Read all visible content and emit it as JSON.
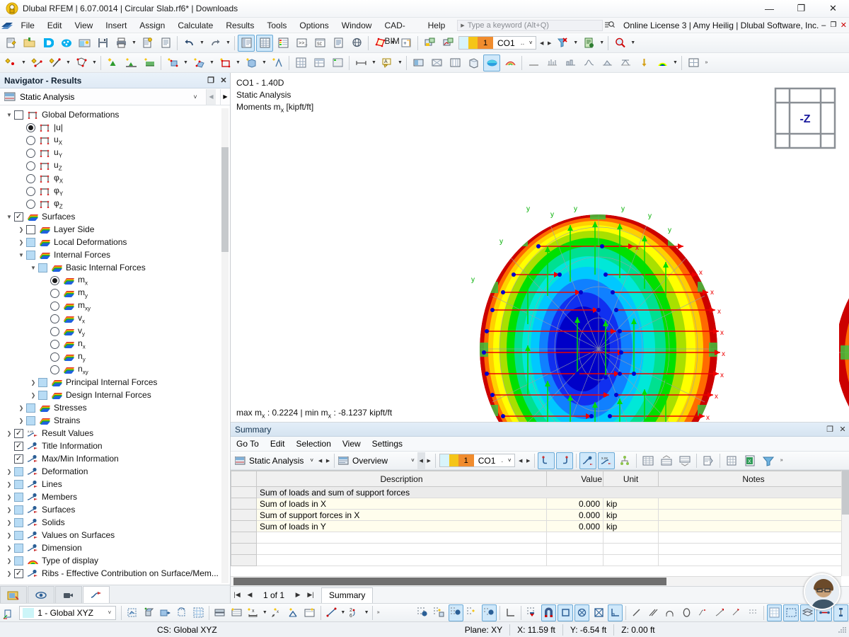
{
  "window": {
    "title": "Dlubal RFEM | 6.07.0014 | Circular Slab.rf6* | Downloads",
    "minimize": "—",
    "maximize": "❐",
    "close": "✕"
  },
  "menubar": {
    "items": [
      "File",
      "Edit",
      "View",
      "Insert",
      "Assign",
      "Calculate",
      "Results",
      "Tools",
      "Options",
      "Window",
      "CAD-BIM",
      "Help"
    ],
    "quick_find_placeholder": "Type a keyword (Alt+Q)",
    "license": "Online License 3 | Amy Heilig | Dlubal Software, Inc."
  },
  "toolbar": {
    "load_case": {
      "number": "1",
      "name": "CO1",
      "dots": ".."
    }
  },
  "navigator": {
    "title": "Navigator - Results",
    "restore_label": "❐",
    "close_label": "✕",
    "analysis_type": "Static Analysis",
    "tree": [
      {
        "label": "Global Deformations",
        "indent": 0,
        "expander": "v",
        "ctl": "check",
        "checked": false,
        "icon": "frame-icon"
      },
      {
        "label": "|u|",
        "indent": 1,
        "expander": "",
        "ctl": "radio",
        "checked": true,
        "icon": "frame-icon"
      },
      {
        "label": "uX",
        "indent": 1,
        "expander": "",
        "ctl": "radio",
        "checked": false,
        "icon": "frame-icon"
      },
      {
        "label": "uY",
        "indent": 1,
        "expander": "",
        "ctl": "radio",
        "checked": false,
        "icon": "frame-icon"
      },
      {
        "label": "uZ",
        "indent": 1,
        "expander": "",
        "ctl": "radio",
        "checked": false,
        "icon": "frame-icon"
      },
      {
        "label": "φX",
        "indent": 1,
        "expander": "",
        "ctl": "radio",
        "checked": false,
        "icon": "frame-icon"
      },
      {
        "label": "φY",
        "indent": 1,
        "expander": "",
        "ctl": "radio",
        "checked": false,
        "icon": "frame-icon"
      },
      {
        "label": "φZ",
        "indent": 1,
        "expander": "",
        "ctl": "radio",
        "checked": false,
        "icon": "frame-icon"
      },
      {
        "label": "Surfaces",
        "indent": 0,
        "expander": "v",
        "ctl": "check",
        "checked": true,
        "icon": "surface-icon"
      },
      {
        "label": "Layer Side",
        "indent": 1,
        "expander": ">",
        "ctl": "check",
        "checked": false,
        "icon": "surface-icon"
      },
      {
        "label": "Local Deformations",
        "indent": 1,
        "expander": ">",
        "ctl": "check-blue",
        "checked": false,
        "icon": "surface-icon"
      },
      {
        "label": "Internal Forces",
        "indent": 1,
        "expander": "v",
        "ctl": "check-blue",
        "checked": false,
        "icon": "surface-icon"
      },
      {
        "label": "Basic Internal Forces",
        "indent": 2,
        "expander": "v",
        "ctl": "check-blue",
        "checked": false,
        "icon": "surface-icon"
      },
      {
        "label": "mx",
        "indent": 3,
        "expander": "",
        "ctl": "radio",
        "checked": true,
        "icon": "surface-icon"
      },
      {
        "label": "my",
        "indent": 3,
        "expander": "",
        "ctl": "radio",
        "checked": false,
        "icon": "surface-icon"
      },
      {
        "label": "mxy",
        "indent": 3,
        "expander": "",
        "ctl": "radio",
        "checked": false,
        "icon": "surface-icon"
      },
      {
        "label": "vx",
        "indent": 3,
        "expander": "",
        "ctl": "radio",
        "checked": false,
        "icon": "surface-icon"
      },
      {
        "label": "vy",
        "indent": 3,
        "expander": "",
        "ctl": "radio",
        "checked": false,
        "icon": "surface-icon"
      },
      {
        "label": "nx",
        "indent": 3,
        "expander": "",
        "ctl": "radio",
        "checked": false,
        "icon": "surface-icon"
      },
      {
        "label": "ny",
        "indent": 3,
        "expander": "",
        "ctl": "radio",
        "checked": false,
        "icon": "surface-icon"
      },
      {
        "label": "nxy",
        "indent": 3,
        "expander": "",
        "ctl": "radio",
        "checked": false,
        "icon": "surface-icon"
      },
      {
        "label": "Principal Internal Forces",
        "indent": 2,
        "expander": ">",
        "ctl": "check-blue",
        "checked": false,
        "icon": "surface-icon"
      },
      {
        "label": "Design Internal Forces",
        "indent": 2,
        "expander": ">",
        "ctl": "check-blue",
        "checked": false,
        "icon": "surface-icon"
      },
      {
        "label": "Stresses",
        "indent": 1,
        "expander": ">",
        "ctl": "check-blue",
        "checked": false,
        "icon": "surface-icon"
      },
      {
        "label": "Strains",
        "indent": 1,
        "expander": ">",
        "ctl": "check-blue",
        "checked": false,
        "icon": "surface-icon"
      },
      {
        "label": "Result Values",
        "indent": 0,
        "expander": ">",
        "ctl": "check",
        "checked": true,
        "icon": "values-icon"
      },
      {
        "label": "Title Information",
        "indent": 0,
        "expander": "",
        "ctl": "check",
        "checked": true,
        "icon": "info-icon"
      },
      {
        "label": "Max/Min Information",
        "indent": 0,
        "expander": "",
        "ctl": "check",
        "checked": true,
        "icon": "info-icon"
      },
      {
        "label": "Deformation",
        "indent": 0,
        "expander": ">",
        "ctl": "check-blue",
        "checked": false,
        "icon": "info-icon"
      },
      {
        "label": "Lines",
        "indent": 0,
        "expander": ">",
        "ctl": "check-blue",
        "checked": false,
        "icon": "info-icon"
      },
      {
        "label": "Members",
        "indent": 0,
        "expander": ">",
        "ctl": "check-blue",
        "checked": false,
        "icon": "info-icon"
      },
      {
        "label": "Surfaces",
        "indent": 0,
        "expander": ">",
        "ctl": "check-blue",
        "checked": false,
        "icon": "info-icon"
      },
      {
        "label": "Solids",
        "indent": 0,
        "expander": ">",
        "ctl": "check-blue",
        "checked": false,
        "icon": "info-icon"
      },
      {
        "label": "Values on Surfaces",
        "indent": 0,
        "expander": ">",
        "ctl": "check-blue",
        "checked": false,
        "icon": "info-icon"
      },
      {
        "label": "Dimension",
        "indent": 0,
        "expander": ">",
        "ctl": "check-blue",
        "checked": false,
        "icon": "info-icon"
      },
      {
        "label": "Type of display",
        "indent": 0,
        "expander": ">",
        "ctl": "check-blue",
        "checked": false,
        "icon": "rainbow-icon"
      },
      {
        "label": "Ribs - Effective Contribution on Surface/Mem...",
        "indent": 0,
        "expander": ">",
        "ctl": "check",
        "checked": true,
        "icon": "info-icon"
      }
    ],
    "tabs": [
      "project-navigator-tab",
      "display-navigator-tab",
      "views-navigator-tab",
      "results-navigator-tab"
    ]
  },
  "viewport": {
    "title_line1": "CO1 - 1.40D",
    "title_line2": "Static Analysis",
    "title_line3_prefix": "Moments m",
    "title_line3_sub": "x",
    "title_line3_suffix": " [kipft/ft]",
    "maxmin_prefix": "max m",
    "maxmin_sub1": "x",
    "maxmin_mid": " : 0.2224 | min m",
    "maxmin_sub2": "x",
    "maxmin_suffix": " : -8.1237 kipft/ft",
    "nav_cube_label": "-Z",
    "axis_x": "X",
    "axis_y": "Y",
    "local_x": "x",
    "local_y": "y"
  },
  "summary": {
    "title": "Summary",
    "restore_label": "❐",
    "close_label": "✕",
    "menu": [
      "Go To",
      "Edit",
      "Selection",
      "View",
      "Settings"
    ],
    "analysis_type": "Static Analysis",
    "view_mode": "Overview",
    "load_case": {
      "number": "1",
      "name": "CO1",
      "dots": "."
    },
    "columns": [
      "",
      "Description",
      "Value",
      "Unit",
      "Notes"
    ],
    "group_row": "Sum of loads and sum of support forces",
    "rows": [
      {
        "idx": "",
        "description": "Sum of loads in X",
        "value": "0.000",
        "unit": "kip",
        "notes": ""
      },
      {
        "idx": "",
        "description": "Sum of support forces in X",
        "value": "0.000",
        "unit": "kip",
        "notes": ""
      },
      {
        "idx": "",
        "description": "Sum of loads in Y",
        "value": "0.000",
        "unit": "kip",
        "notes": ""
      }
    ],
    "page_label": "1 of 1",
    "tab_label": "Summary"
  },
  "bottombar": {
    "cs_value": "1 - Global XYZ",
    "overflow": "»"
  },
  "statusbar": {
    "cs": "CS: Global XYZ",
    "plane": "Plane: XY",
    "x": "X: 11.59 ft",
    "y": "Y: -6.54 ft",
    "z": "Z: 0.00 ft"
  },
  "colors": {
    "accent": "#f08c2e",
    "selection": "#cfe8fa",
    "contour": [
      "#cc0000",
      "#ff6600",
      "#ffcc00",
      "#ffff00",
      "#99e000",
      "#00e000",
      "#00e090",
      "#00e8d8",
      "#00d0ff",
      "#0088ff",
      "#0000ee",
      "#0000aa"
    ]
  }
}
